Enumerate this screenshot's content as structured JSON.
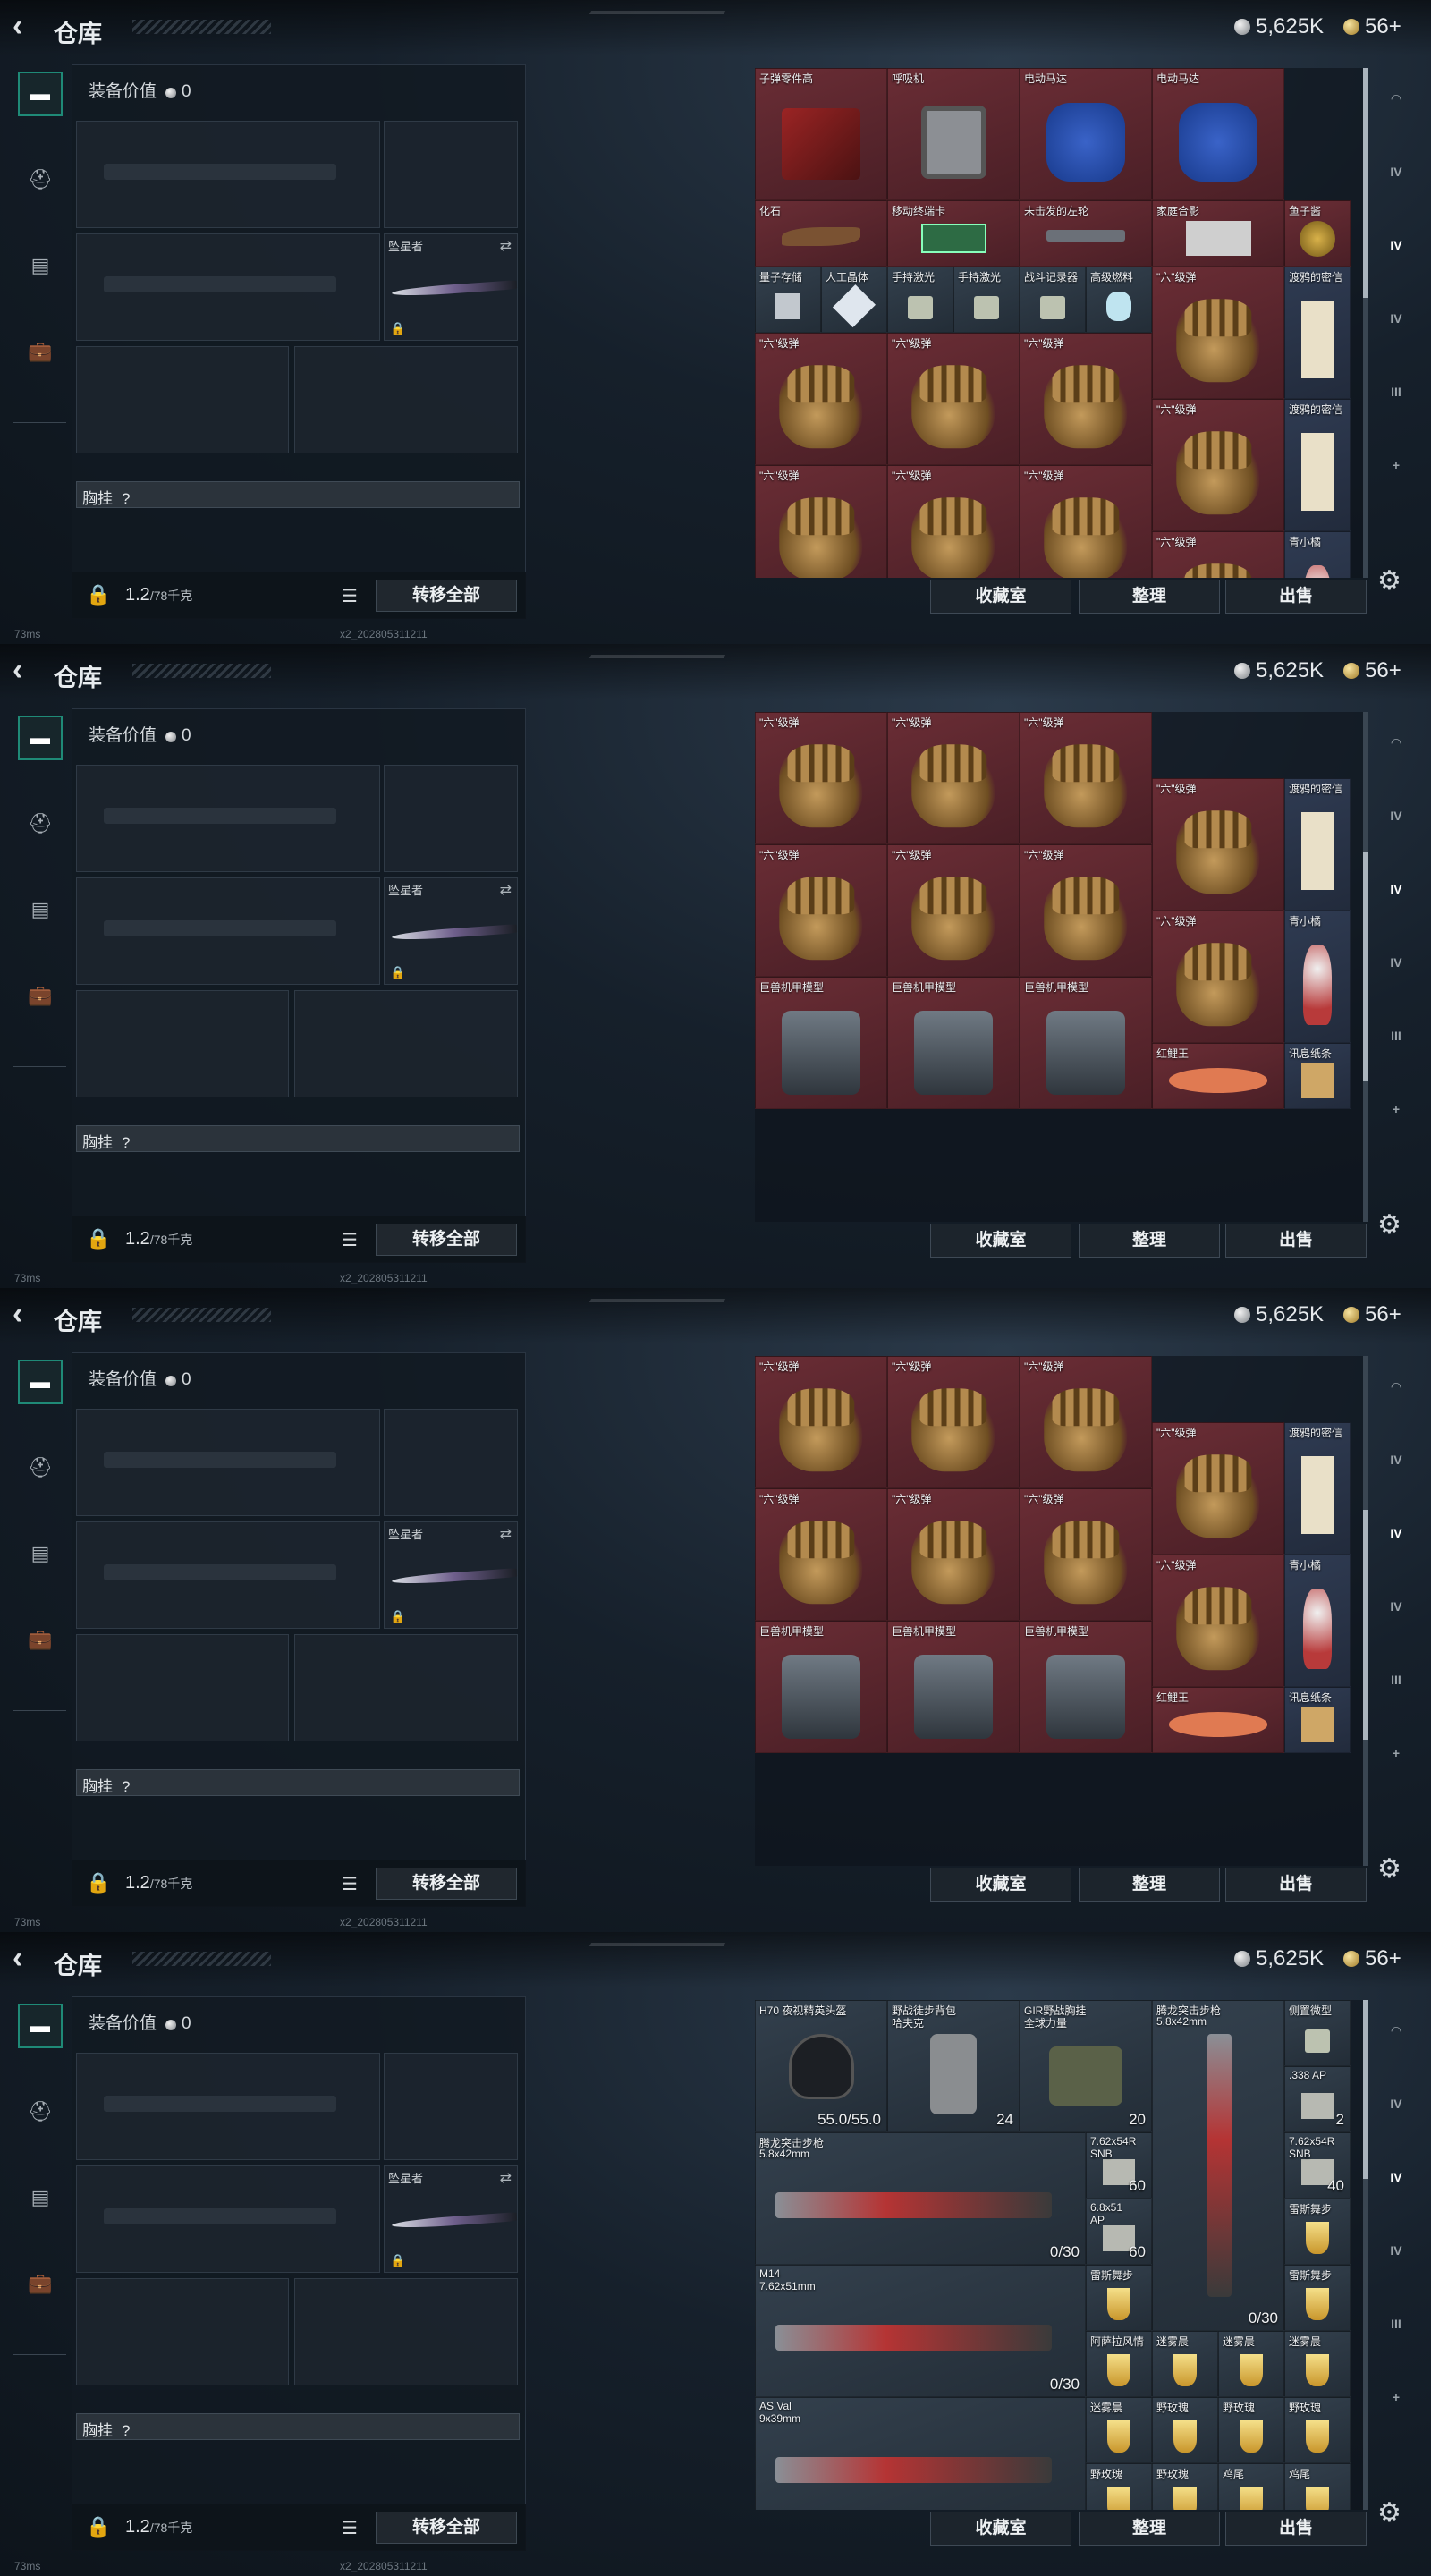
{
  "header": {
    "title": "仓库",
    "silver": "5,625K",
    "gold": "56+",
    "back_icon": "back-arrow-icon"
  },
  "left_nav": [
    {
      "icon": "pistol-icon",
      "active": true
    },
    {
      "icon": "helmet-icon"
    },
    {
      "icon": "vest-icon"
    },
    {
      "icon": "briefcase-icon"
    }
  ],
  "equipment": {
    "value_label": "装备价值",
    "value": "0",
    "melee_label": "坠星者",
    "chest_label": "胸挂",
    "chest_help": "?",
    "weight": "1.2",
    "weight_max": "/78千克",
    "transfer_label": "转移全部"
  },
  "footer": {
    "ping": "73ms",
    "version": "x2_202805311211"
  },
  "buttons": {
    "collection": "收藏室",
    "sort": "整理",
    "sell": "出售"
  },
  "right_nav": [
    {
      "label": "◠"
    },
    {
      "label": "IV"
    },
    {
      "label": "IV"
    },
    {
      "label": "IV"
    },
    {
      "label": "III"
    },
    {
      "label": "+"
    }
  ],
  "screens": [
    {
      "items": [
        {
          "name": "子弹零件高",
          "color": "red",
          "c": 0,
          "r": 0,
          "w": 2,
          "h": 2,
          "art": "machine"
        },
        {
          "name": "呼吸机",
          "color": "red",
          "c": 2,
          "r": 0,
          "w": 2,
          "h": 2,
          "art": "device"
        },
        {
          "name": "电动马达",
          "color": "red",
          "c": 4,
          "r": 0,
          "w": 2,
          "h": 2,
          "art": "motor"
        },
        {
          "name": "电动马达",
          "color": "red",
          "c": 6,
          "r": 0,
          "w": 2,
          "h": 2,
          "art": "motor"
        },
        {
          "name": "化石",
          "color": "red",
          "c": 0,
          "r": 2,
          "w": 2,
          "h": 1,
          "art": "claw"
        },
        {
          "name": "移动终端卡",
          "color": "red",
          "c": 2,
          "r": 2,
          "w": 2,
          "h": 1,
          "art": "board"
        },
        {
          "name": "未击发的左轮",
          "color": "red",
          "c": 4,
          "r": 2,
          "w": 2,
          "h": 1,
          "art": "revolver"
        },
        {
          "name": "家庭合影",
          "color": "red",
          "c": 6,
          "r": 2,
          "w": 2,
          "h": 1,
          "art": "photo"
        },
        {
          "name": "鱼子酱",
          "color": "red",
          "c": 8,
          "r": 2,
          "w": 1,
          "h": 1,
          "art": "tin"
        },
        {
          "name": "量子存储",
          "color": "dark",
          "c": 0,
          "r": 3,
          "w": 1,
          "h": 1,
          "art": "chip"
        },
        {
          "name": "人工晶体",
          "color": "dark",
          "c": 1,
          "r": 3,
          "w": 1,
          "h": 1,
          "art": "crystal"
        },
        {
          "name": "手持激光",
          "color": "dark",
          "c": 2,
          "r": 3,
          "w": 1,
          "h": 1,
          "art": "small"
        },
        {
          "name": "手持激光",
          "color": "dark",
          "c": 3,
          "r": 3,
          "w": 1,
          "h": 1,
          "art": "small"
        },
        {
          "name": "战斗记录器",
          "color": "dark",
          "c": 4,
          "r": 3,
          "w": 1,
          "h": 1,
          "art": "small"
        },
        {
          "name": "高级燃料",
          "color": "dark",
          "c": 5,
          "r": 3,
          "w": 1,
          "h": 1,
          "art": "can"
        },
        {
          "name": "\"六\"级弹",
          "color": "red",
          "c": 6,
          "r": 3,
          "w": 2,
          "h": 2,
          "art": "hand"
        },
        {
          "name": "渡鸦的密信",
          "color": "blue",
          "c": 8,
          "r": 3,
          "w": 1,
          "h": 2,
          "art": "paper"
        },
        {
          "name": "\"六\"级弹",
          "color": "red",
          "c": 0,
          "r": 4,
          "w": 2,
          "h": 2,
          "art": "hand"
        },
        {
          "name": "\"六\"级弹",
          "color": "red",
          "c": 2,
          "r": 4,
          "w": 2,
          "h": 2,
          "art": "hand"
        },
        {
          "name": "\"六\"级弹",
          "color": "red",
          "c": 4,
          "r": 4,
          "w": 2,
          "h": 2,
          "art": "hand"
        },
        {
          "name": "\"六\"级弹",
          "color": "red",
          "c": 6,
          "r": 5,
          "w": 2,
          "h": 2,
          "art": "hand"
        },
        {
          "name": "渡鸦的密信",
          "color": "blue",
          "c": 8,
          "r": 5,
          "w": 1,
          "h": 2,
          "art": "paper"
        },
        {
          "name": "\"六\"级弹",
          "color": "red",
          "c": 0,
          "r": 6,
          "w": 2,
          "h": 2,
          "art": "hand"
        },
        {
          "name": "\"六\"级弹",
          "color": "red",
          "c": 2,
          "r": 6,
          "w": 2,
          "h": 2,
          "art": "hand"
        },
        {
          "name": "\"六\"级弹",
          "color": "red",
          "c": 4,
          "r": 6,
          "w": 2,
          "h": 2,
          "art": "hand"
        },
        {
          "name": "\"六\"级弹",
          "color": "red",
          "c": 6,
          "r": 7,
          "w": 2,
          "h": 2,
          "art": "hand"
        },
        {
          "name": "青小橘",
          "color": "blue",
          "c": 8,
          "r": 7,
          "w": 1,
          "h": 2,
          "art": "figure"
        }
      ],
      "scroll": {
        "thumb_top": 0.0,
        "thumb_size": 0.45
      }
    },
    {
      "items": [
        {
          "name": "\"六\"级弹",
          "color": "red",
          "c": 0,
          "r": 0,
          "w": 2,
          "h": 2,
          "art": "hand"
        },
        {
          "name": "\"六\"级弹",
          "color": "red",
          "c": 2,
          "r": 0,
          "w": 2,
          "h": 2,
          "art": "hand"
        },
        {
          "name": "\"六\"级弹",
          "color": "red",
          "c": 4,
          "r": 0,
          "w": 2,
          "h": 2,
          "art": "hand"
        },
        {
          "name": "\"六\"级弹",
          "color": "red",
          "c": 6,
          "r": 1,
          "w": 2,
          "h": 2,
          "art": "hand"
        },
        {
          "name": "渡鸦的密信",
          "color": "blue",
          "c": 8,
          "r": 1,
          "w": 1,
          "h": 2,
          "art": "paper"
        },
        {
          "name": "\"六\"级弹",
          "color": "red",
          "c": 0,
          "r": 2,
          "w": 2,
          "h": 2,
          "art": "hand"
        },
        {
          "name": "\"六\"级弹",
          "color": "red",
          "c": 2,
          "r": 2,
          "w": 2,
          "h": 2,
          "art": "hand"
        },
        {
          "name": "\"六\"级弹",
          "color": "red",
          "c": 4,
          "r": 2,
          "w": 2,
          "h": 2,
          "art": "hand"
        },
        {
          "name": "\"六\"级弹",
          "color": "red",
          "c": 6,
          "r": 3,
          "w": 2,
          "h": 2,
          "art": "hand"
        },
        {
          "name": "青小橘",
          "color": "blue",
          "c": 8,
          "r": 3,
          "w": 1,
          "h": 2,
          "art": "figure"
        },
        {
          "name": "巨兽机甲模型",
          "color": "red",
          "c": 0,
          "r": 4,
          "w": 2,
          "h": 2,
          "art": "mech"
        },
        {
          "name": "巨兽机甲模型",
          "color": "red",
          "c": 2,
          "r": 4,
          "w": 2,
          "h": 2,
          "art": "mech"
        },
        {
          "name": "巨兽机甲模型",
          "color": "red",
          "c": 4,
          "r": 4,
          "w": 2,
          "h": 2,
          "art": "mech"
        },
        {
          "name": "红鲤王",
          "color": "red",
          "c": 6,
          "r": 5,
          "w": 2,
          "h": 1,
          "art": "fish"
        },
        {
          "name": "讯息纸条",
          "color": "blue",
          "c": 8,
          "r": 5,
          "w": 1,
          "h": 1,
          "art": "note"
        }
      ],
      "scroll": {
        "thumb_top": 0.5,
        "thumb_size": 0.45
      }
    },
    {
      "items": [
        {
          "name": "\"六\"级弹",
          "color": "red",
          "c": 0,
          "r": 0,
          "w": 2,
          "h": 2,
          "art": "hand"
        },
        {
          "name": "\"六\"级弹",
          "color": "red",
          "c": 2,
          "r": 0,
          "w": 2,
          "h": 2,
          "art": "hand"
        },
        {
          "name": "\"六\"级弹",
          "color": "red",
          "c": 4,
          "r": 0,
          "w": 2,
          "h": 2,
          "art": "hand"
        },
        {
          "name": "\"六\"级弹",
          "color": "red",
          "c": 6,
          "r": 1,
          "w": 2,
          "h": 2,
          "art": "hand"
        },
        {
          "name": "渡鸦的密信",
          "color": "blue",
          "c": 8,
          "r": 1,
          "w": 1,
          "h": 2,
          "art": "paper"
        },
        {
          "name": "\"六\"级弹",
          "color": "red",
          "c": 0,
          "r": 2,
          "w": 2,
          "h": 2,
          "art": "hand"
        },
        {
          "name": "\"六\"级弹",
          "color": "red",
          "c": 2,
          "r": 2,
          "w": 2,
          "h": 2,
          "art": "hand"
        },
        {
          "name": "\"六\"级弹",
          "color": "red",
          "c": 4,
          "r": 2,
          "w": 2,
          "h": 2,
          "art": "hand"
        },
        {
          "name": "\"六\"级弹",
          "color": "red",
          "c": 6,
          "r": 3,
          "w": 2,
          "h": 2,
          "art": "hand"
        },
        {
          "name": "青小橘",
          "color": "blue",
          "c": 8,
          "r": 3,
          "w": 1,
          "h": 2,
          "art": "figure"
        },
        {
          "name": "巨兽机甲模型",
          "color": "red",
          "c": 0,
          "r": 4,
          "w": 2,
          "h": 2,
          "art": "mech"
        },
        {
          "name": "巨兽机甲模型",
          "color": "red",
          "c": 2,
          "r": 4,
          "w": 2,
          "h": 2,
          "art": "mech"
        },
        {
          "name": "巨兽机甲模型",
          "color": "red",
          "c": 4,
          "r": 4,
          "w": 2,
          "h": 2,
          "art": "mech"
        },
        {
          "name": "红鲤王",
          "color": "red",
          "c": 6,
          "r": 5,
          "w": 2,
          "h": 1,
          "art": "fish"
        },
        {
          "name": "讯息纸条",
          "color": "blue",
          "c": 8,
          "r": 5,
          "w": 1,
          "h": 1,
          "art": "note"
        }
      ],
      "scroll": {
        "thumb_top": 0.55,
        "thumb_size": 0.45
      }
    },
    {
      "items": [
        {
          "name": "H70 夜视精英头盔",
          "color": "dark",
          "c": 0,
          "r": 0,
          "w": 2,
          "h": 2,
          "art": "helmet",
          "value": "55.0/55.0"
        },
        {
          "name": "野战徒步背包",
          "sub": "哈夫克",
          "color": "dark",
          "c": 2,
          "r": 0,
          "w": 2,
          "h": 2,
          "art": "bag",
          "value": "24"
        },
        {
          "name": "GIR野战胸挂",
          "sub": "全球力量",
          "color": "dark",
          "c": 4,
          "r": 0,
          "w": 2,
          "h": 2,
          "art": "vest",
          "value": "20"
        },
        {
          "name": "腾龙突击步枪",
          "sub": "5.8x42mm",
          "color": "dark",
          "c": 6,
          "r": 0,
          "w": 2,
          "h": 5,
          "art": "rifle-v",
          "value": "0/30"
        },
        {
          "name": "侧置微型",
          "color": "dark",
          "c": 8,
          "r": 0,
          "w": 1,
          "h": 1,
          "art": "small"
        },
        {
          "name": ".338 AP",
          "color": "dark",
          "c": 8,
          "r": 1,
          "w": 1,
          "h": 1,
          "art": "ammo",
          "value": "2"
        },
        {
          "name": "腾龙突击步枪",
          "sub": "5.8x42mm",
          "color": "dark",
          "c": 0,
          "r": 2,
          "w": 5,
          "h": 2,
          "art": "rifle",
          "value": "0/30"
        },
        {
          "name": "7.62x54R",
          "sub": "SNB",
          "color": "dark",
          "c": 5,
          "r": 2,
          "w": 1,
          "h": 1,
          "art": "ammo",
          "value": "60"
        },
        {
          "name": "7.62x54R",
          "sub": "SNB",
          "color": "dark",
          "c": 8,
          "r": 2,
          "w": 1,
          "h": 1,
          "art": "ammo",
          "value": "40"
        },
        {
          "name": "6.8x51",
          "sub": "AP",
          "color": "dark",
          "c": 5,
          "r": 3,
          "w": 1,
          "h": 1,
          "art": "ammo",
          "value": "60"
        },
        {
          "name": "雷斯舞步",
          "color": "dark",
          "c": 8,
          "r": 3,
          "w": 1,
          "h": 1,
          "art": "drink"
        },
        {
          "name": "M14",
          "sub": "7.62x51mm",
          "color": "dark",
          "c": 0,
          "r": 4,
          "w": 5,
          "h": 2,
          "art": "rifle",
          "value": "0/30"
        },
        {
          "name": "雷斯舞步",
          "color": "dark",
          "c": 5,
          "r": 4,
          "w": 1,
          "h": 1,
          "art": "drink"
        },
        {
          "name": "雷斯舞步",
          "color": "dark",
          "c": 8,
          "r": 4,
          "w": 1,
          "h": 1,
          "art": "drink"
        },
        {
          "name": "阿萨拉风情",
          "color": "dark",
          "c": 5,
          "r": 5,
          "w": 1,
          "h": 1,
          "art": "drink"
        },
        {
          "name": "迷雾晨",
          "color": "dark",
          "c": 6,
          "r": 5,
          "w": 1,
          "h": 1,
          "art": "drink"
        },
        {
          "name": "迷雾晨",
          "color": "dark",
          "c": 7,
          "r": 5,
          "w": 1,
          "h": 1,
          "art": "drink"
        },
        {
          "name": "迷雾晨",
          "color": "dark",
          "c": 8,
          "r": 5,
          "w": 1,
          "h": 1,
          "art": "drink"
        },
        {
          "name": "AS Val",
          "sub": "9x39mm",
          "color": "dark",
          "c": 0,
          "r": 6,
          "w": 5,
          "h": 2,
          "art": "rifle"
        },
        {
          "name": "迷雾晨",
          "color": "dark",
          "c": 5,
          "r": 6,
          "w": 1,
          "h": 1,
          "art": "drink"
        },
        {
          "name": "野玫瑰",
          "color": "dark",
          "c": 6,
          "r": 6,
          "w": 1,
          "h": 1,
          "art": "drink"
        },
        {
          "name": "野玫瑰",
          "color": "dark",
          "c": 7,
          "r": 6,
          "w": 1,
          "h": 1,
          "art": "drink"
        },
        {
          "name": "野玫瑰",
          "color": "dark",
          "c": 8,
          "r": 6,
          "w": 1,
          "h": 1,
          "art": "drink"
        },
        {
          "name": "野玫瑰",
          "color": "dark",
          "c": 5,
          "r": 7,
          "w": 1,
          "h": 1,
          "art": "drink"
        },
        {
          "name": "野玫瑰",
          "color": "dark",
          "c": 6,
          "r": 7,
          "w": 1,
          "h": 1,
          "art": "drink"
        },
        {
          "name": "鸡尾",
          "color": "dark",
          "c": 7,
          "r": 7,
          "w": 1,
          "h": 1,
          "art": "drink"
        },
        {
          "name": "鸡尾",
          "color": "dark",
          "c": 8,
          "r": 7,
          "w": 1,
          "h": 1,
          "art": "drink"
        }
      ],
      "scroll": {
        "thumb_top": 0.0,
        "thumb_size": 0.35
      }
    }
  ]
}
